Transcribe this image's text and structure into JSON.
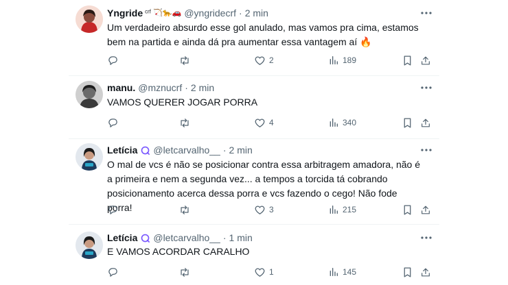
{
  "tweets": [
    {
      "name": "Yngride",
      "badges": "ᶜʳᶠ 🏹🐆🚗",
      "handle": "@yngridecrf",
      "time": "2 min",
      "text": "Um verdadeiro absurdo esse gol anulado, mas vamos pra cima, estamos bem na partida e ainda dá pra aumentar essa vantagem aí 🔥",
      "likes": "2",
      "views": "189",
      "avatar_color": "#c62828"
    },
    {
      "name": "manu.",
      "badges": "",
      "handle": "@mznucrf",
      "time": "2 min",
      "text": "VAMOS QUERER JOGAR PORRA",
      "likes": "4",
      "views": "340",
      "avatar_color": "#5a5a5a"
    },
    {
      "name": "Letícia",
      "badges": "",
      "handle": "@letcarvalho__",
      "time": "2 min",
      "text": "O mal de vcs é não se posicionar contra essa arbitragem amadora, não é a primeira e nem a segunda vez... a tempos a torcida tá cobrando posicionamento acerca dessa porra e vcs fazendo o cego! Não fode porra!",
      "likes": "3",
      "views": "215",
      "avatar_color": "#1f3b5c"
    },
    {
      "name": "Letícia",
      "badges": "",
      "handle": "@letcarvalho__",
      "time": "1 min",
      "text": "E VAMOS ACORDAR CARALHO",
      "likes": "1",
      "views": "145",
      "avatar_color": "#1f3b5c"
    }
  ],
  "separator": "·",
  "colors": {
    "text": "#0f1419",
    "muted": "#536471",
    "border": "#eff3f4",
    "accent": "#7856ff"
  }
}
